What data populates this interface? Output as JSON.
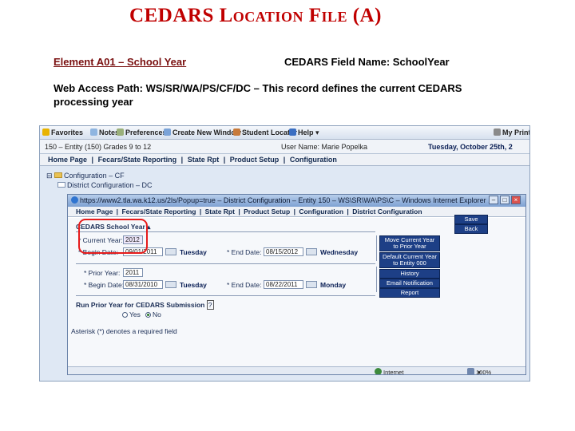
{
  "slide": {
    "title": "CEDARS Location File (A)",
    "element_label": "Element A01 – School Year",
    "field_name": "CEDARS Field Name: SchoolYear",
    "web_path": "Web Access Path: WS/SR/WA/PS/CF/DC – This record defines the current CEDARS processing year"
  },
  "ie_toolbar": {
    "favorites": "Favorites",
    "notes": "Notes",
    "preferences": "Preferences",
    "create_window": "Create New Window",
    "student_locator": "Student Locator",
    "help": "Help",
    "my_print": "My Print Q"
  },
  "entity_bar": {
    "entity": "150 – Entity (150) Grades 9 to 12",
    "user": "User Name: Marie Popelka",
    "date": "Tuesday, October 25th, 2"
  },
  "app_menu": [
    "Home Page",
    "|",
    "Fecars/State Reporting",
    "|",
    "State Rpt",
    "|",
    "Product Setup",
    "|",
    "Configuration"
  ],
  "tree": {
    "configuration": "Configuration – CF",
    "district_configuration": "District Configuration – DC"
  },
  "popup": {
    "titlebar": "https://www2.tla.wa.k12.us/2ls/Popup=true – District Configuration – Entity 150 – WS\\SR\\WA\\PS\\C – Windows Internet Explorer ...",
    "menu": [
      "Home Page",
      "|",
      "Fecars/State Reporting",
      "|",
      "State Rpt",
      "|",
      "Product Setup",
      "|",
      "Configuration",
      "|",
      "District Configuration"
    ],
    "panel_header": "CEDARS School Year",
    "current_year_label": "* Current Year:",
    "current_year": "2012",
    "begin_date_label": "* Begin Date:",
    "begin_date": "09/01/2011",
    "begin_day": "Tuesday",
    "end_date_label": "* End Date:",
    "end_date": "08/15/2012",
    "end_day": "Wednesday",
    "prior_year_label": "* Prior Year:",
    "prior_year": "2011",
    "prior_begin_label": "* Begin Date:",
    "prior_begin_date": "08/31/2010",
    "prior_begin_day": "Tuesday",
    "prior_end_label": "* End Date:",
    "prior_end_date": "08/22/2011",
    "prior_end_day": "Monday",
    "run_prior_label": "Run Prior Year for CEDARS Submission",
    "help_mark": "?",
    "yes_label": "Yes",
    "no_label": "No",
    "footnote": "Asterisk (*) denotes a required field",
    "buttons": {
      "save": "Save",
      "back": "Back",
      "move_line1": "Move Current Year",
      "move_line2": "to Prior Year",
      "default_line1": "Default Current Year",
      "default_line2": "to Entity 000",
      "history": "History",
      "email": "Email Notification",
      "report": "Report"
    },
    "status": {
      "internet": "Internet",
      "zoom": "100%"
    }
  }
}
